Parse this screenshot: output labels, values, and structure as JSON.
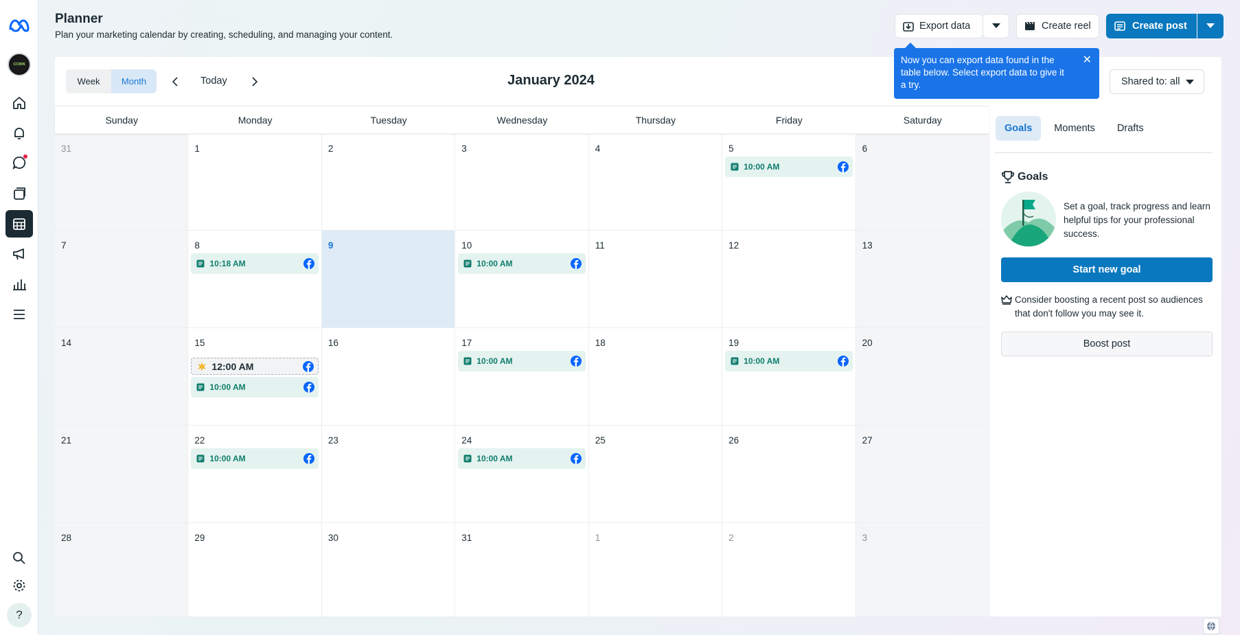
{
  "header": {
    "title": "Planner",
    "subtitle": "Plan your marketing calendar by creating, scheduling, and managing your content.",
    "export_label": "Export data",
    "create_reel_label": "Create reel",
    "create_post_label": "Create post"
  },
  "tooltip": {
    "text": "Now you can export data found in the table below. Select export data to give it a try.",
    "close": "✕"
  },
  "toolbar": {
    "week_label": "Week",
    "month_label": "Month",
    "today_label": "Today",
    "month_title": "January 2024",
    "shared_label": "Shared to: all"
  },
  "calendar": {
    "days_of_week": [
      "Sunday",
      "Monday",
      "Tuesday",
      "Wednesday",
      "Thursday",
      "Friday",
      "Saturday"
    ],
    "weeks": [
      [
        {
          "day": "31",
          "other": true
        },
        {
          "day": "1"
        },
        {
          "day": "2"
        },
        {
          "day": "3"
        },
        {
          "day": "4"
        },
        {
          "day": "5",
          "events": [
            {
              "time": "10:00 AM",
              "kind": "post"
            }
          ]
        },
        {
          "day": "6"
        }
      ],
      [
        {
          "day": "7"
        },
        {
          "day": "8",
          "events": [
            {
              "time": "10:18 AM",
              "kind": "post"
            }
          ]
        },
        {
          "day": "9",
          "today": true
        },
        {
          "day": "10",
          "events": [
            {
              "time": "10:00 AM",
              "kind": "post"
            }
          ]
        },
        {
          "day": "11"
        },
        {
          "day": "12"
        },
        {
          "day": "13"
        }
      ],
      [
        {
          "day": "14"
        },
        {
          "day": "15",
          "events": [
            {
              "time": "12:00 AM",
              "kind": "draft"
            },
            {
              "time": "10:00 AM",
              "kind": "post"
            }
          ]
        },
        {
          "day": "16"
        },
        {
          "day": "17",
          "events": [
            {
              "time": "10:00 AM",
              "kind": "post"
            }
          ]
        },
        {
          "day": "18"
        },
        {
          "day": "19",
          "events": [
            {
              "time": "10:00 AM",
              "kind": "post"
            }
          ]
        },
        {
          "day": "20"
        }
      ],
      [
        {
          "day": "21"
        },
        {
          "day": "22",
          "events": [
            {
              "time": "10:00 AM",
              "kind": "post"
            }
          ]
        },
        {
          "day": "23"
        },
        {
          "day": "24",
          "events": [
            {
              "time": "10:00 AM",
              "kind": "post"
            }
          ]
        },
        {
          "day": "25"
        },
        {
          "day": "26"
        },
        {
          "day": "27"
        }
      ],
      [
        {
          "day": "28"
        },
        {
          "day": "29"
        },
        {
          "day": "30"
        },
        {
          "day": "31"
        },
        {
          "day": "1",
          "other": true
        },
        {
          "day": "2",
          "other": true
        },
        {
          "day": "3",
          "other": true
        }
      ]
    ]
  },
  "panel": {
    "tabs": [
      "Goals",
      "Moments",
      "Drafts"
    ],
    "goals_heading": "Goals",
    "goals_text": "Set a goal, track progress and learn helpful tips for your professional success.",
    "start_goal_label": "Start new goal",
    "boost_tip": "Consider boosting a recent post so audiences that don't follow you may see it.",
    "boost_label": "Boost post"
  },
  "rail": {
    "avatar_text": "CCWIN",
    "icons": [
      "meta-logo-icon",
      "home-icon",
      "notifications-icon",
      "inbox-icon",
      "content-icon",
      "planner-icon",
      "ads-icon",
      "insights-icon",
      "menu-icon",
      "search-icon",
      "settings-icon",
      "help-icon"
    ]
  },
  "colors": {
    "accent": "#0a78be",
    "event_bg": "#e4f3ef",
    "event_text": "#0f7d6e",
    "today_bg": "#deebf7"
  }
}
